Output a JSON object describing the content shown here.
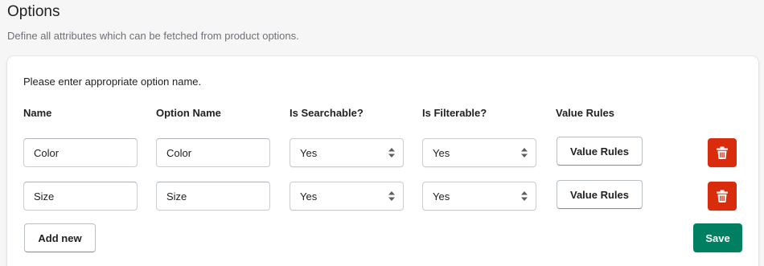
{
  "header": {
    "title": "Options",
    "subtitle": "Define all attributes which can be fetched from product options."
  },
  "card": {
    "hint": "Please enter appropriate option name.",
    "columns": {
      "name": "Name",
      "option_name": "Option Name",
      "searchable": "Is Searchable?",
      "filterable": "Is Filterable?",
      "value_rules": "Value Rules"
    },
    "rows": [
      {
        "name": "Color",
        "option_name": "Color",
        "searchable": "Yes",
        "filterable": "Yes",
        "value_rules_label": "Value Rules"
      },
      {
        "name": "Size",
        "option_name": "Size",
        "searchable": "Yes",
        "filterable": "Yes",
        "value_rules_label": "Value Rules"
      }
    ],
    "add_new_label": "Add new",
    "save_label": "Save"
  },
  "colors": {
    "danger": "#d82c0d",
    "primary": "#008060"
  },
  "icons": {
    "delete": "trash-icon",
    "select": "select-arrows-icon"
  }
}
